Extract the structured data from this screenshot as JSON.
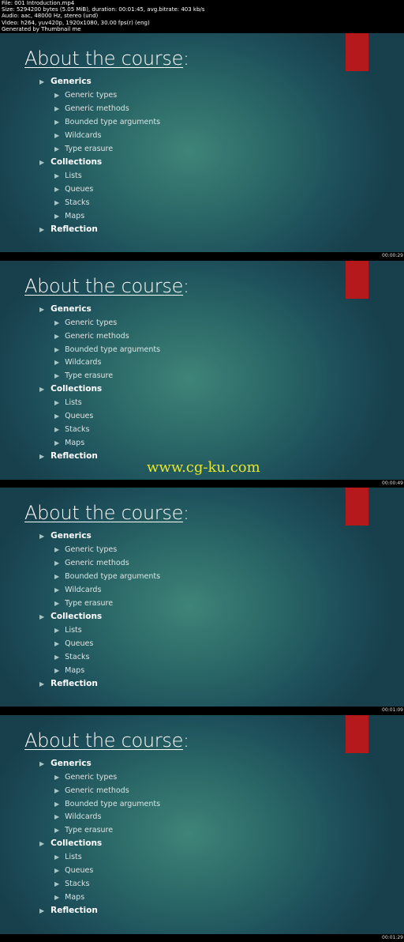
{
  "header": {
    "lines": [
      "File: 001 Introduction.mp4",
      "Size: 5294200 bytes (5.05 MiB), duration: 00:01:45, avg.bitrate: 403 kb/s",
      "Audio: aac, 48000 Hz, stereo (und)",
      "Video: h264, yuv420p, 1920x1080, 30.00 fps(r) (eng)",
      "Generated by Thumbnail me"
    ]
  },
  "slide": {
    "title": "About the course",
    "title_suffix": ":",
    "outline": [
      {
        "label": "Generics",
        "children": [
          "Generic types",
          "Generic methods",
          "Bounded type arguments",
          "Wildcards",
          "Type erasure"
        ]
      },
      {
        "label": "Collections",
        "children": [
          "Lists",
          "Queues",
          "Stacks",
          "Maps"
        ]
      },
      {
        "label": "Reflection",
        "children": []
      }
    ],
    "accent_color": "#b5191c"
  },
  "frames": [
    {
      "timestamp": "00:00:29"
    },
    {
      "timestamp": "00:00:49",
      "watermark": "www.cg-ku.com"
    },
    {
      "timestamp": "00:01:09"
    },
    {
      "timestamp": "00:01:29"
    }
  ]
}
